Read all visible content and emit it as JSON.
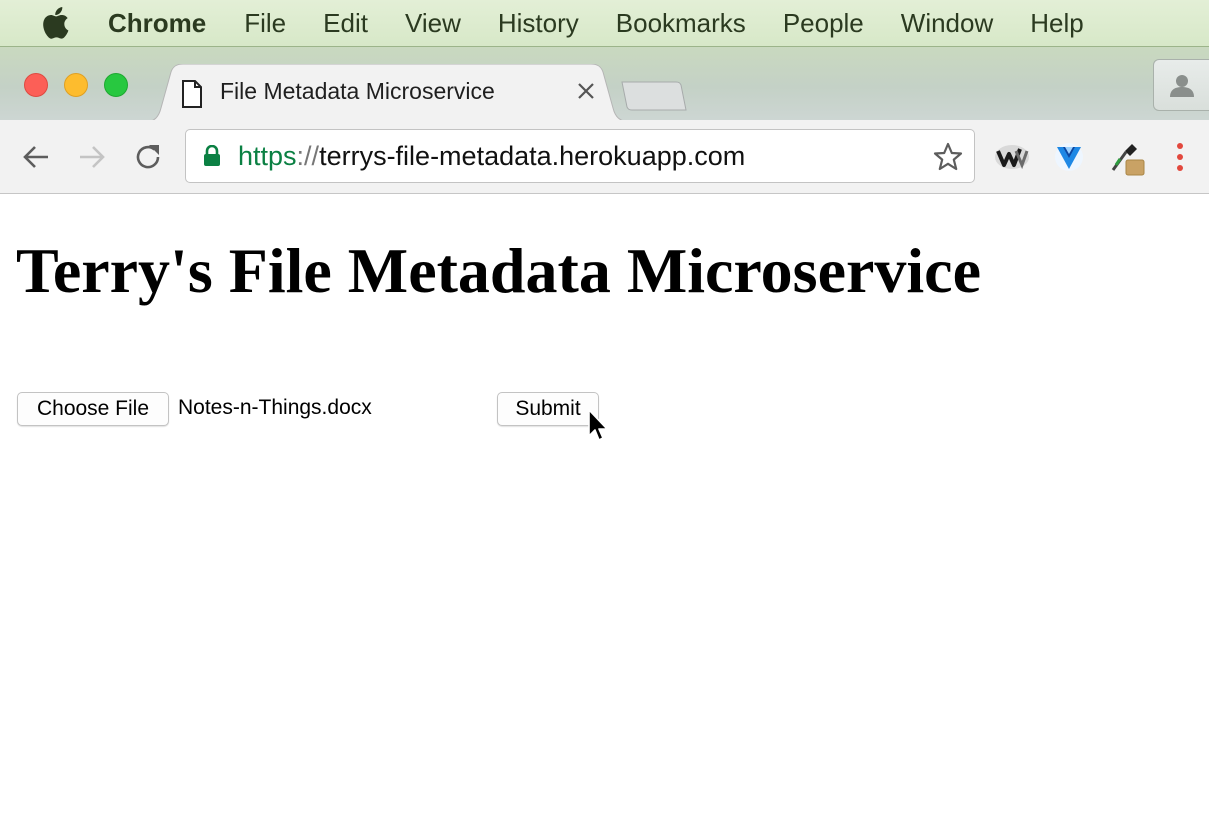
{
  "menubar": {
    "apple_icon": "apple-logo-icon",
    "app_name": "Chrome",
    "items": [
      "File",
      "Edit",
      "View",
      "History",
      "Bookmarks",
      "People",
      "Window",
      "Help"
    ]
  },
  "tab": {
    "title": "File Metadata Microservice",
    "favicon": "document-icon"
  },
  "address_bar": {
    "scheme": "https",
    "separator": "://",
    "host": "terrys-file-metadata.herokuapp.com"
  },
  "page": {
    "heading": "Terry's File Metadata Microservice",
    "choose_file_label": "Choose File",
    "selected_file": "Notes-n-Things.docx",
    "submit_label": "Submit"
  },
  "colors": {
    "secure_green": "#0b8043",
    "traffic_close": "#fc5f57",
    "traffic_min": "#fdbc2e",
    "traffic_max": "#28c840",
    "menu_accent": "#e2483d"
  }
}
